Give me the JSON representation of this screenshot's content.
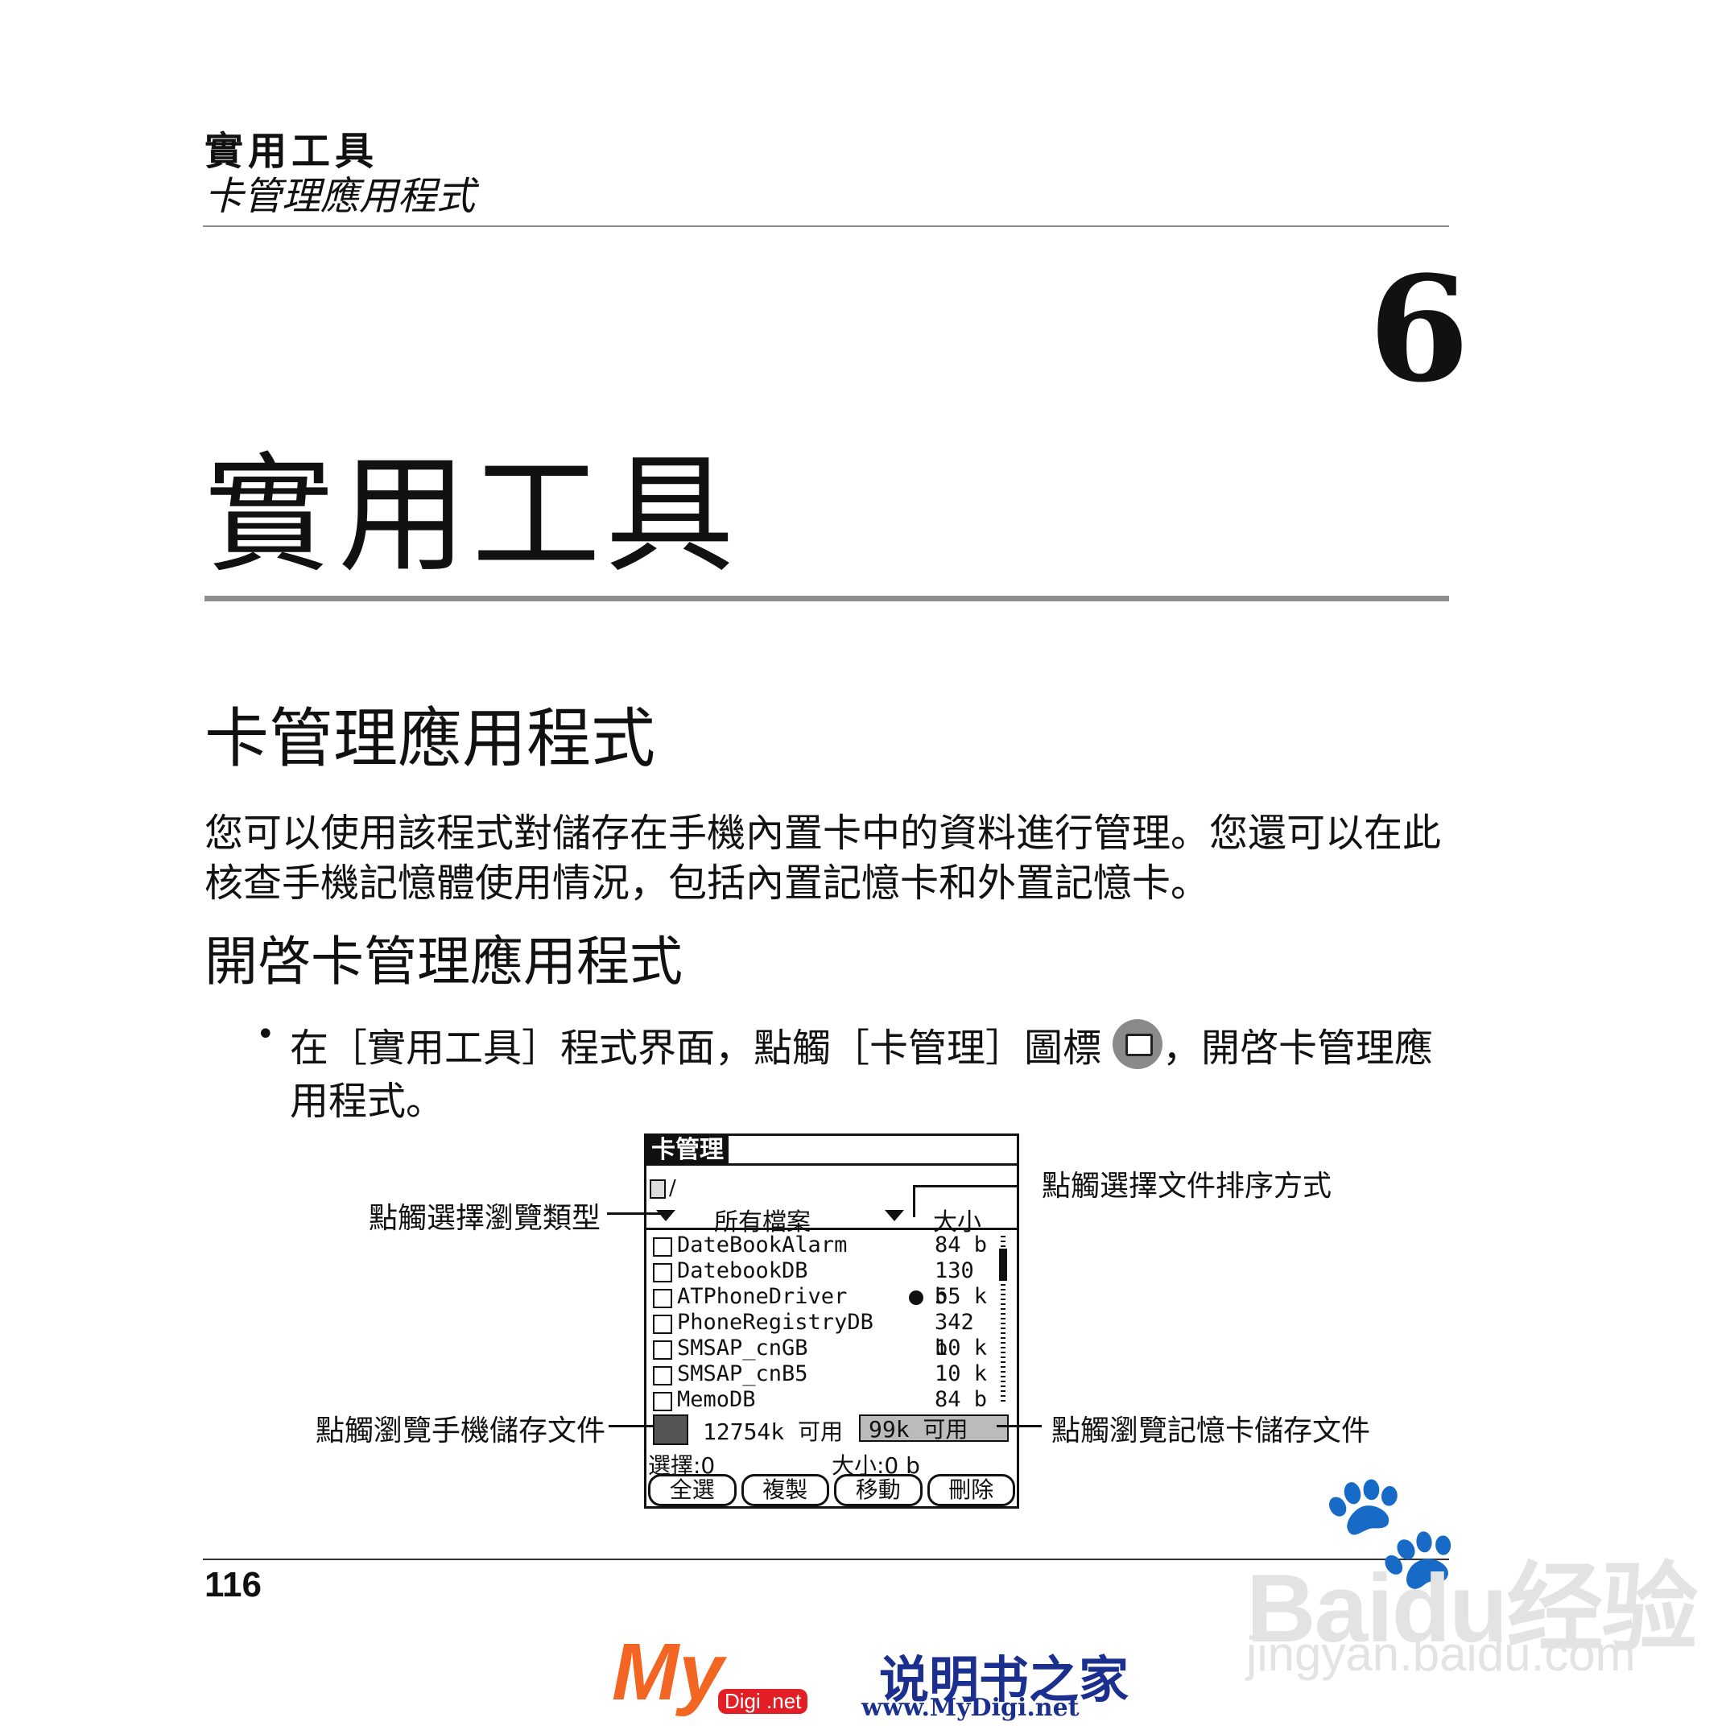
{
  "header": {
    "title": "實用工具",
    "subtitle": "卡管理應用程式"
  },
  "chapter": {
    "number": "6",
    "title": "實用工具"
  },
  "section": {
    "title": "卡管理應用程式",
    "intro": "您可以使用該程式對儲存在手機內置卡中的資料進行管理。您還可以在此核查手機記憶體使用情況，包括內置記憶卡和外置記憶卡。"
  },
  "subsection": {
    "title": "開啓卡管理應用程式",
    "bullet_line1_before": "在［實用工具］程式界面，點觸［卡管理］圖標",
    "bullet_line1_after": "，開啓卡管理應",
    "bullet_line2": "用程式。"
  },
  "palm": {
    "app_title": "卡管理",
    "path": "/",
    "view_type": "所有檔案",
    "sort_by": "大小",
    "files": [
      {
        "name": "DateBookAlarm",
        "size": "84 b",
        "locked": false
      },
      {
        "name": "DatebookDB",
        "size": "130 b",
        "locked": false
      },
      {
        "name": "ATPhoneDriver",
        "size": "55 k",
        "locked": true
      },
      {
        "name": "PhoneRegistryDB",
        "size": "342 b",
        "locked": false
      },
      {
        "name": "SMSAP_cnGB",
        "size": "10 k",
        "locked": false
      },
      {
        "name": "SMSAP_cnB5",
        "size": "10 k",
        "locked": false
      },
      {
        "name": "MemoDB",
        "size": "84 b",
        "locked": false
      }
    ],
    "phone_free": "12754k 可用",
    "card_free": "99k 可用",
    "selected": "選擇:0",
    "size_total": "大小:0 b",
    "buttons": [
      "全選",
      "複製",
      "移動",
      "刪除"
    ]
  },
  "callouts": {
    "sort": "點觸選擇文件排序方式",
    "view_type": "點觸選擇瀏覽類型",
    "phone_storage": "點觸瀏覽手機儲存文件",
    "card_storage": "點觸瀏覽記憶卡儲存文件"
  },
  "footer": {
    "page_number": "116"
  },
  "watermarks": {
    "baidu": "Baidu经验",
    "baidu_url": "jingyan.baidu.com",
    "mydigi_logo": "My",
    "mydigi_badge": "Digi .net",
    "mydigi_cn": "说明书之家",
    "mydigi_url": "www.MyDigi.net"
  }
}
